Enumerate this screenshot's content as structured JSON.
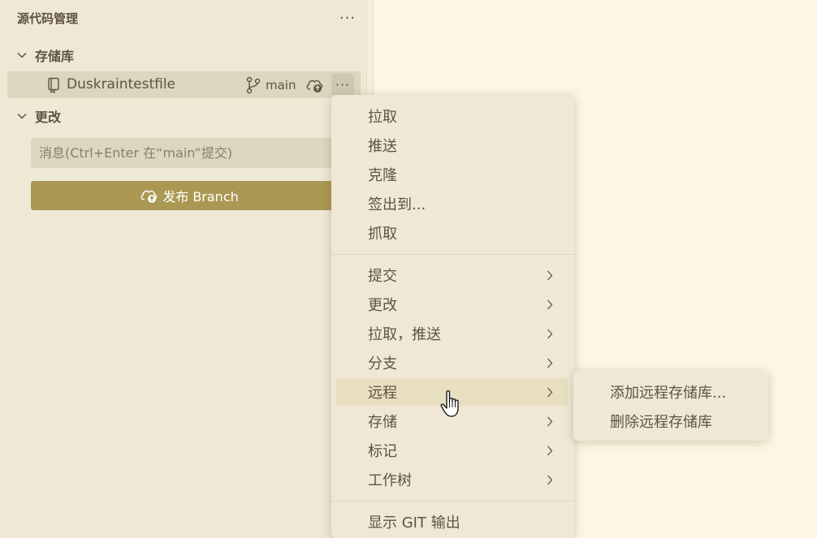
{
  "sidebar": {
    "title": "源代码管理",
    "more_icon": "ellipsis-icon",
    "repositories": {
      "label": "存储库",
      "repo": {
        "name": "Duskraintestfile",
        "branch": "main",
        "icons": [
          "repo-icon",
          "branch-icon",
          "cloud-upload-icon",
          "ellipsis-icon"
        ]
      }
    },
    "changes": {
      "label": "更改",
      "commit_placeholder": "消息(Ctrl+Enter 在“main”提交)",
      "publish_label": "发布 Branch"
    }
  },
  "menu": {
    "group1": [
      "拉取",
      "推送",
      "克隆",
      "签出到...",
      "抓取"
    ],
    "group2": [
      "提交",
      "更改",
      "拉取，推送",
      "分支",
      "远程",
      "存储",
      "标记",
      "工作树"
    ],
    "group3": [
      "显示 GIT 输出"
    ],
    "active_item": "远程"
  },
  "submenu": {
    "items": [
      "添加远程存储库...",
      "删除远程存储库"
    ]
  },
  "colors": {
    "sidebar_bg": "#eee8d5",
    "editor_bg": "#fdf6e3",
    "accent_button": "#ab9853",
    "menu_bg": "#efe8d6",
    "menu_active": "#e8dfc1",
    "text": "#5f5341"
  }
}
